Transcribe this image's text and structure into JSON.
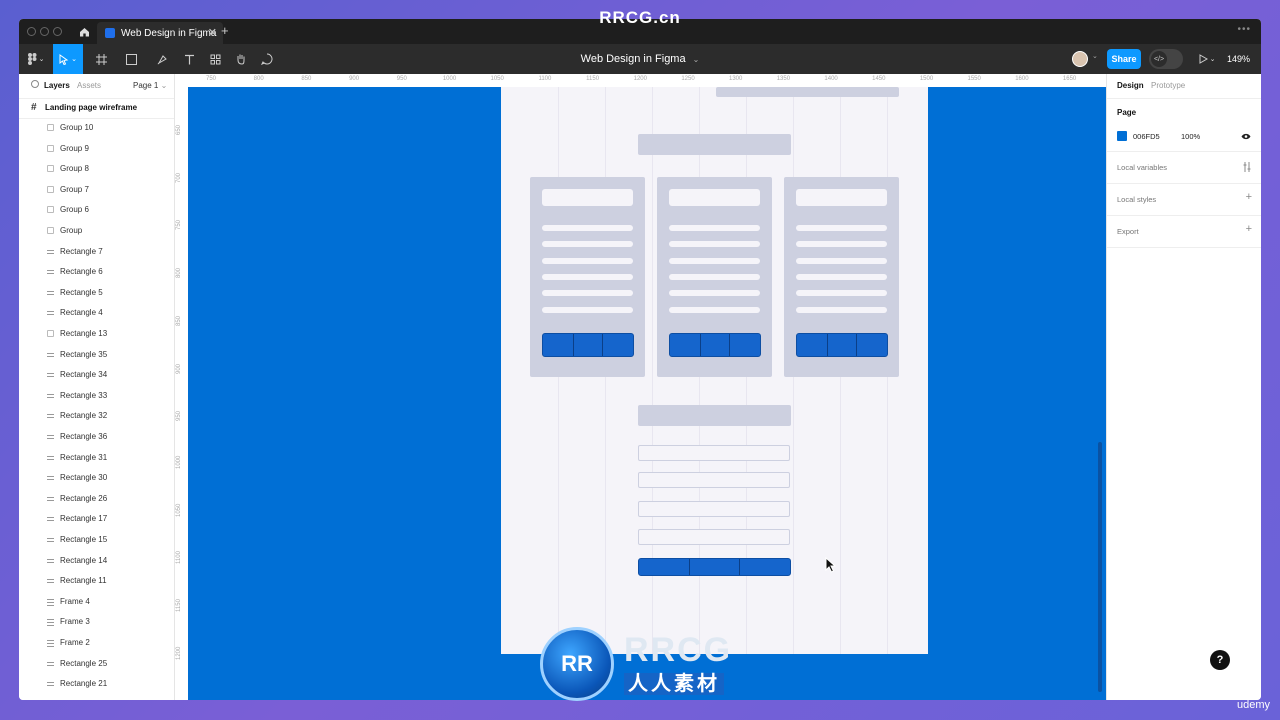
{
  "watermark_top": "RRCG.cn",
  "watermark_logo": {
    "mark": "RR",
    "main": "RRCG",
    "sub": "人人素材"
  },
  "udemy_label": "udemy",
  "tab": {
    "title": "Web Design in Figma"
  },
  "toolbar": {
    "document_title": "Web Design in Figma",
    "document_caret": "⌄",
    "share_label": "Share",
    "zoom_label": "149%"
  },
  "left_panel": {
    "tabs": {
      "layers": "Layers",
      "assets": "Assets",
      "page": "Page 1"
    },
    "frame_name": "Landing page wireframe",
    "layers": [
      {
        "name": "Group 10",
        "type": "group"
      },
      {
        "name": "Group 9",
        "type": "group"
      },
      {
        "name": "Group 8",
        "type": "group"
      },
      {
        "name": "Group 7",
        "type": "group"
      },
      {
        "name": "Group 6",
        "type": "group"
      },
      {
        "name": "Group",
        "type": "group"
      },
      {
        "name": "Rectangle 7",
        "type": "rect"
      },
      {
        "name": "Rectangle 6",
        "type": "rect"
      },
      {
        "name": "Rectangle 5",
        "type": "rect"
      },
      {
        "name": "Rectangle 4",
        "type": "rect"
      },
      {
        "name": "Rectangle 13",
        "type": "group"
      },
      {
        "name": "Rectangle 35",
        "type": "rect"
      },
      {
        "name": "Rectangle 34",
        "type": "rect"
      },
      {
        "name": "Rectangle 33",
        "type": "rect"
      },
      {
        "name": "Rectangle 32",
        "type": "rect"
      },
      {
        "name": "Rectangle 36",
        "type": "rect"
      },
      {
        "name": "Rectangle 31",
        "type": "rect"
      },
      {
        "name": "Rectangle 30",
        "type": "rect"
      },
      {
        "name": "Rectangle 26",
        "type": "rect"
      },
      {
        "name": "Rectangle 17",
        "type": "rect"
      },
      {
        "name": "Rectangle 15",
        "type": "rect"
      },
      {
        "name": "Rectangle 14",
        "type": "rect"
      },
      {
        "name": "Rectangle 11",
        "type": "rect"
      },
      {
        "name": "Frame 4",
        "type": "frame"
      },
      {
        "name": "Frame 3",
        "type": "frame"
      },
      {
        "name": "Frame 2",
        "type": "frame"
      },
      {
        "name": "Rectangle 25",
        "type": "rect"
      },
      {
        "name": "Rectangle 21",
        "type": "rect"
      }
    ]
  },
  "ruler_top": [
    "750",
    "800",
    "850",
    "900",
    "950",
    "1000",
    "1050",
    "1100",
    "1150",
    "1200",
    "1250",
    "1300",
    "1350",
    "1400",
    "1450",
    "1500",
    "1550",
    "1600",
    "1650"
  ],
  "ruler_left": [
    "650",
    "700",
    "750",
    "800",
    "850",
    "900",
    "950",
    "1000",
    "1050",
    "1100",
    "1150",
    "1200"
  ],
  "right_panel": {
    "tabs": {
      "design": "Design",
      "prototype": "Prototype"
    },
    "page_heading": "Page",
    "page_color_hex": "006FD5",
    "page_opacity": "100%",
    "page_swatch_color": "#006FD5",
    "local_variables": "Local variables",
    "local_styles": "Local styles",
    "export": "Export"
  },
  "help_label": "?",
  "colors": {
    "canvas": "#006FD5",
    "accent": "#0D99FF",
    "wireframe_block": "#CDD0E0",
    "wireframe_button": "#1565CC"
  }
}
